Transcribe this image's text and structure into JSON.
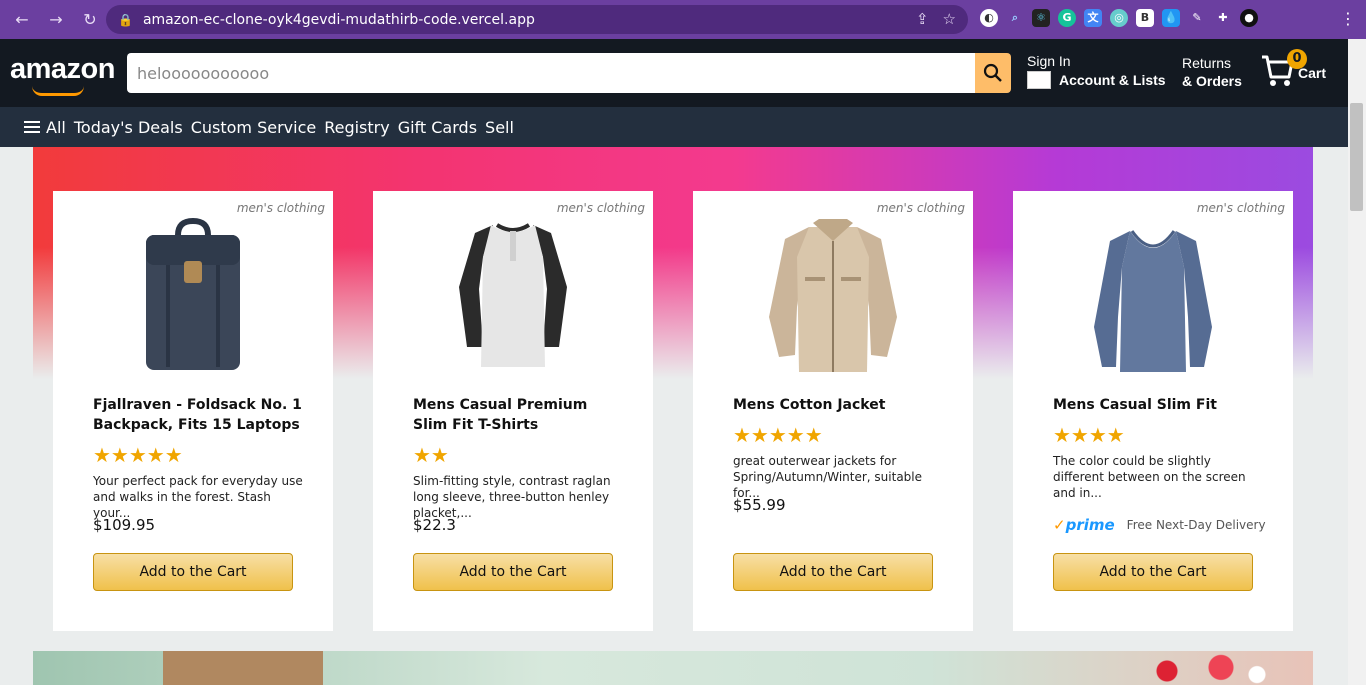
{
  "browser": {
    "url": "amazon-ec-clone-oyk4gevdi-mudathirb-code.vercel.app"
  },
  "header": {
    "logo": "amazon",
    "search_value": "helooooooooooo",
    "signin_line1": "Sign In",
    "signin_line2": "Account & Lists",
    "returns_line1": "Returns",
    "returns_line2": "& Orders",
    "cart_count": "0",
    "cart_label": "Cart"
  },
  "subnav": {
    "items": [
      "All",
      "Today's Deals",
      "Custom Service",
      "Registry",
      "Gift Cards",
      "Sell"
    ]
  },
  "products": [
    {
      "category": "men's clothing",
      "title": "Fjallraven - Foldsack No. 1 Backpack, Fits 15 Laptops",
      "rating": 5,
      "stars": "★★★★★",
      "description": "Your perfect pack for everyday use and walks in the forest. Stash your...",
      "price": "$109.95",
      "button": "Add to the Cart"
    },
    {
      "category": "men's clothing",
      "title": "Mens Casual Premium Slim Fit T-Shirts",
      "rating": 2,
      "stars": "★★",
      "description": "Slim-fitting style, contrast raglan long sleeve, three-button henley placket,...",
      "price": "$22.3",
      "button": "Add to the Cart"
    },
    {
      "category": "men's clothing",
      "title": "Mens Cotton Jacket",
      "rating": 5,
      "stars": "★★★★★",
      "description": "great outerwear jackets for Spring/Autumn/Winter, suitable for...",
      "price": "$55.99",
      "button": "Add to the Cart"
    },
    {
      "category": "men's clothing",
      "title": "Mens Casual Slim Fit",
      "rating": 4,
      "stars": "★★★★",
      "description": "The color could be slightly different between on the screen and in...",
      "prime_label": "prime",
      "prime_delivery": "Free Next-Day Delivery",
      "button": "Add to the Cart"
    }
  ],
  "colors": {
    "header_bg": "#131921",
    "subnav_bg": "#232f3e",
    "star": "#f0a500",
    "button": "#f0c14b",
    "browser_chrome": "#6b3fa0"
  }
}
